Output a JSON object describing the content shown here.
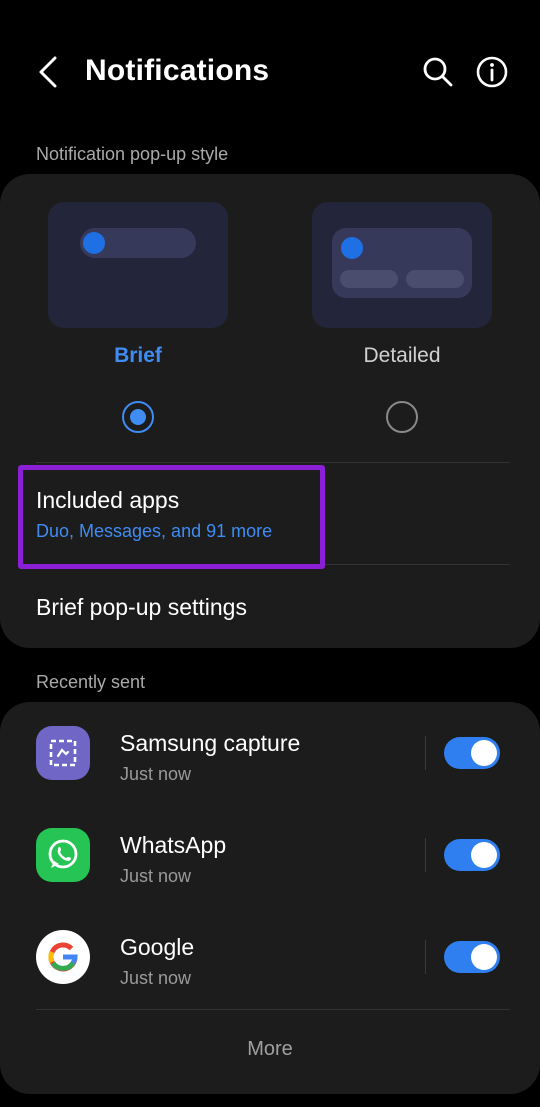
{
  "header": {
    "title": "Notifications",
    "back_icon": "chevron-left-icon",
    "search_icon": "search-icon",
    "info_icon": "info-icon"
  },
  "popup_style": {
    "section_label": "Notification pop-up style",
    "options": [
      {
        "label": "Brief",
        "selected": true
      },
      {
        "label": "Detailed",
        "selected": false
      }
    ],
    "included_apps": {
      "title": "Included apps",
      "subtitle": "Duo, Messages, and 91 more"
    },
    "brief_settings": {
      "title": "Brief pop-up settings"
    }
  },
  "recently_sent": {
    "section_label": "Recently sent",
    "apps": [
      {
        "name": "Samsung capture",
        "time": "Just now",
        "enabled": true,
        "icon": "samsung-capture-icon"
      },
      {
        "name": "WhatsApp",
        "time": "Just now",
        "enabled": true,
        "icon": "whatsapp-icon"
      },
      {
        "name": "Google",
        "time": "Just now",
        "enabled": true,
        "icon": "google-icon"
      }
    ],
    "more_label": "More"
  },
  "colors": {
    "accent": "#3f8cf3",
    "highlight": "#8b1fd6",
    "card_bg": "#1c1c1c",
    "toggle_on": "#2f7ff1"
  }
}
